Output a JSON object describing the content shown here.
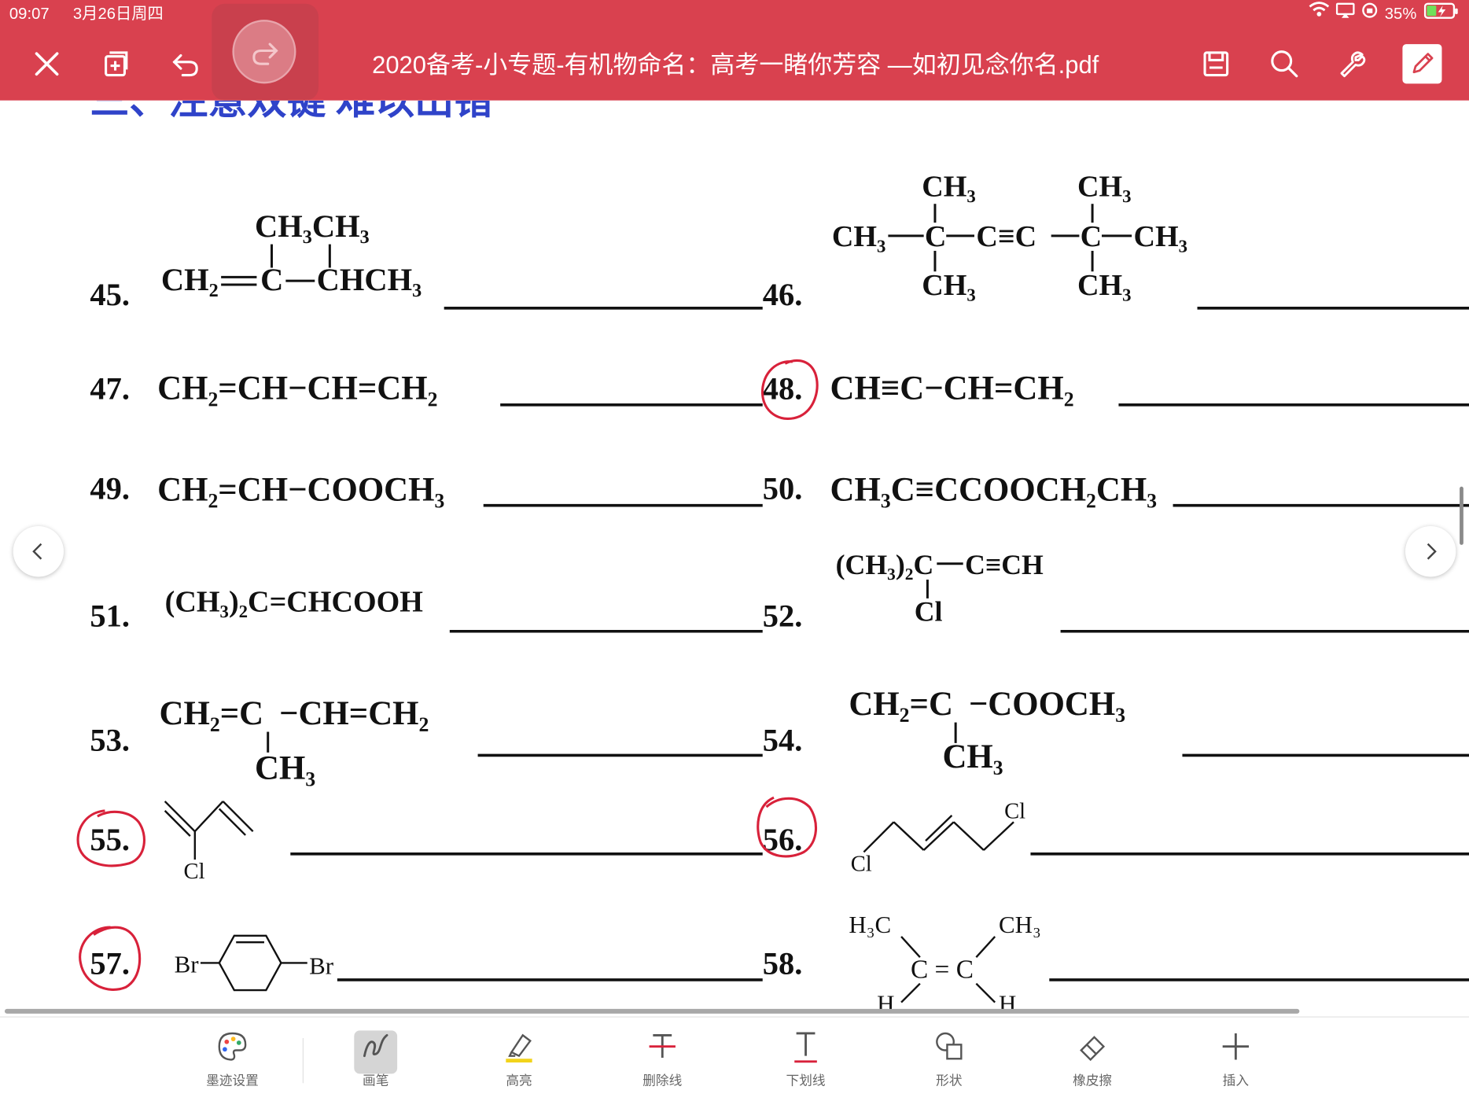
{
  "status_bar": {
    "time": "09:07",
    "date": "3月26日周四",
    "battery": "35%"
  },
  "toolbar_top": {
    "title": "2020备考-小专题-有机物命名：高考一睹你芳容 —如初见念你名.pdf",
    "icons": [
      "close-icon",
      "add-page-icon",
      "undo-icon",
      "redo-icon",
      "save-icon",
      "search-icon",
      "wrench-icon",
      "edit-pen-icon"
    ]
  },
  "colors": {
    "header": "#d9414f",
    "annotation_red": "#d8213a",
    "heading_blue": "#2f43c9"
  },
  "document": {
    "section_heading": "三、注意双键  难以出错",
    "problems": {
      "n45": "45.",
      "n46": "46.",
      "n47": "47.",
      "n48": "48.",
      "n49": "49.",
      "n50": "50.",
      "n51": "51.",
      "n52": "52.",
      "n53": "53.",
      "n54": "54.",
      "n55": "55.",
      "n56": "56.",
      "n57": "57.",
      "n58": "58."
    },
    "formulas": {
      "f47": "CH₂=CH−CH=CH₂",
      "f48": "CH≡C−CH=CH₂",
      "f49": "CH₂=CH−COOCH₃",
      "f50": "CH₃C≡CCOOCH₂CH₃",
      "f51": "(CH₃)₂C=CHCOOH"
    },
    "labels": {
      "ch3": "CH₃",
      "ch3ch3": "CH₃CH₃",
      "ch2": "CH₂",
      "c": "C",
      "chch3": "CHCH₃",
      "cl": "Cl",
      "br": "Br",
      "h3c": "H₃C",
      "h": "H",
      "cc_triple": "C≡C",
      "ch3_2c": "(CH₃)₂C",
      "c_triple_ch": "C≡CH",
      "ch2_eq_c": "CH₂=C",
      "ch_eq_ch2": "−CH=CH₂",
      "cooch3": "−COOCH₃",
      "c_eq_c": "C = C"
    }
  },
  "tools": [
    {
      "label": "墨迹设置",
      "icon": "palette-icon"
    },
    {
      "label": "画笔",
      "icon": "pen-icon"
    },
    {
      "label": "高亮",
      "icon": "highlighter-icon"
    },
    {
      "label": "删除线",
      "icon": "strikethrough-icon"
    },
    {
      "label": "下划线",
      "icon": "underline-icon"
    },
    {
      "label": "形状",
      "icon": "shapes-icon"
    },
    {
      "label": "橡皮擦",
      "icon": "eraser-icon"
    },
    {
      "label": "插入",
      "icon": "plus-icon"
    }
  ]
}
